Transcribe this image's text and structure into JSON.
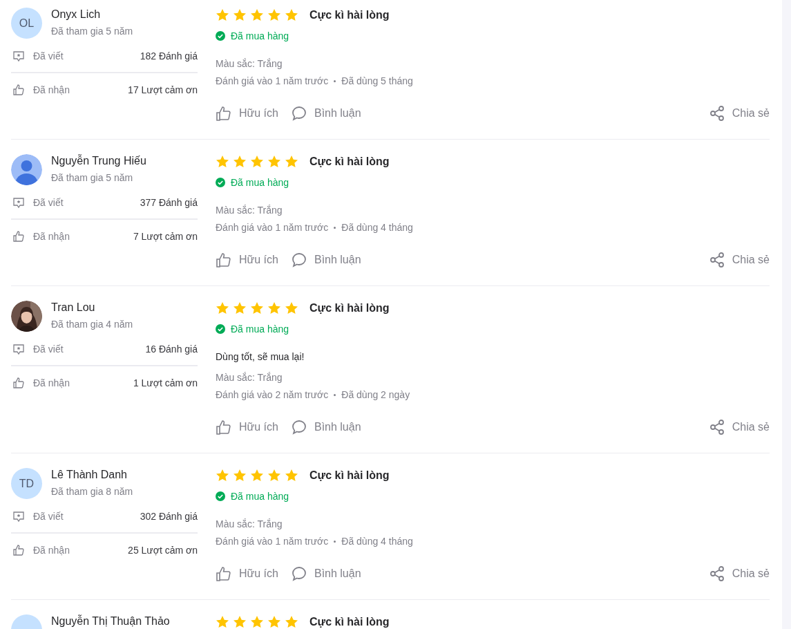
{
  "reviews": [
    {
      "avatar": {
        "kind": "initials",
        "text": "OL"
      },
      "name": "Onyx Lich",
      "joined": "Đã tham gia 5 năm",
      "stats": [
        {
          "kind": "written",
          "label": "Đã viết",
          "value": "182 Đánh giá"
        },
        {
          "kind": "received",
          "label": "Đã nhận",
          "value": "17 Lượt cảm ơn"
        }
      ],
      "stars": 5,
      "title": "Cực kì hài lòng",
      "purchased": "Đã mua hàng",
      "attributes": [
        "Màu sắc: Trắng"
      ],
      "date": "Đánh giá vào 1 năm trước",
      "usage": "Đã dùng 5 tháng",
      "actions": [
        {
          "kind": "like",
          "label": "Hữu ích"
        },
        {
          "kind": "comment",
          "label": "Bình luận"
        },
        {
          "kind": "share",
          "label": "Chia sẻ"
        }
      ]
    },
    {
      "avatar": {
        "kind": "silhouette"
      },
      "name": "Nguyễn Trung Hiếu",
      "joined": "Đã tham gia 5 năm",
      "stats": [
        {
          "kind": "written",
          "label": "Đã viết",
          "value": "377 Đánh giá"
        },
        {
          "kind": "received",
          "label": "Đã nhận",
          "value": "7 Lượt cảm ơn"
        }
      ],
      "stars": 5,
      "title": "Cực kì hài lòng",
      "purchased": "Đã mua hàng",
      "attributes": [
        "Màu sắc: Trắng"
      ],
      "date": "Đánh giá vào 1 năm trước",
      "usage": "Đã dùng 4 tháng",
      "actions": [
        {
          "kind": "like",
          "label": "Hữu ích"
        },
        {
          "kind": "comment",
          "label": "Bình luận"
        },
        {
          "kind": "share",
          "label": "Chia sẻ"
        }
      ]
    },
    {
      "avatar": {
        "kind": "picture"
      },
      "name": "Tran Lou",
      "joined": "Đã tham gia 4 năm",
      "stats": [
        {
          "kind": "written",
          "label": "Đã viết",
          "value": "16 Đánh giá"
        },
        {
          "kind": "received",
          "label": "Đã nhận",
          "value": "1 Lượt cảm ơn"
        }
      ],
      "stars": 5,
      "title": "Cực kì hài lòng",
      "purchased": "Đã mua hàng",
      "content": "Dùng tốt, sẽ mua lại!",
      "attributes": [
        "Màu sắc: Trắng"
      ],
      "date": "Đánh giá vào 2 năm trước",
      "usage": "Đã dùng 2 ngày",
      "actions": [
        {
          "kind": "like",
          "label": "Hữu ích"
        },
        {
          "kind": "comment",
          "label": "Bình luận"
        },
        {
          "kind": "share",
          "label": "Chia sẻ"
        }
      ]
    },
    {
      "avatar": {
        "kind": "initials",
        "text": "TD"
      },
      "name": "Lê Thành Danh",
      "joined": "Đã tham gia 8 năm",
      "stats": [
        {
          "kind": "written",
          "label": "Đã viết",
          "value": "302 Đánh giá"
        },
        {
          "kind": "received",
          "label": "Đã nhận",
          "value": "25 Lượt cảm ơn"
        }
      ],
      "stars": 5,
      "title": "Cực kì hài lòng",
      "purchased": "Đã mua hàng",
      "attributes": [
        "Màu sắc: Trắng"
      ],
      "date": "Đánh giá vào 1 năm trước",
      "usage": "Đã dùng 4 tháng",
      "actions": [
        {
          "kind": "like",
          "label": "Hữu ích"
        },
        {
          "kind": "comment",
          "label": "Bình luận"
        },
        {
          "kind": "share",
          "label": "Chia sẻ"
        }
      ]
    },
    {
      "avatar": {
        "kind": "initials"
      },
      "name": "Nguyễn Thị Thuận Thảo",
      "stars": 5,
      "title": "Cực kì hài lòng"
    }
  ]
}
